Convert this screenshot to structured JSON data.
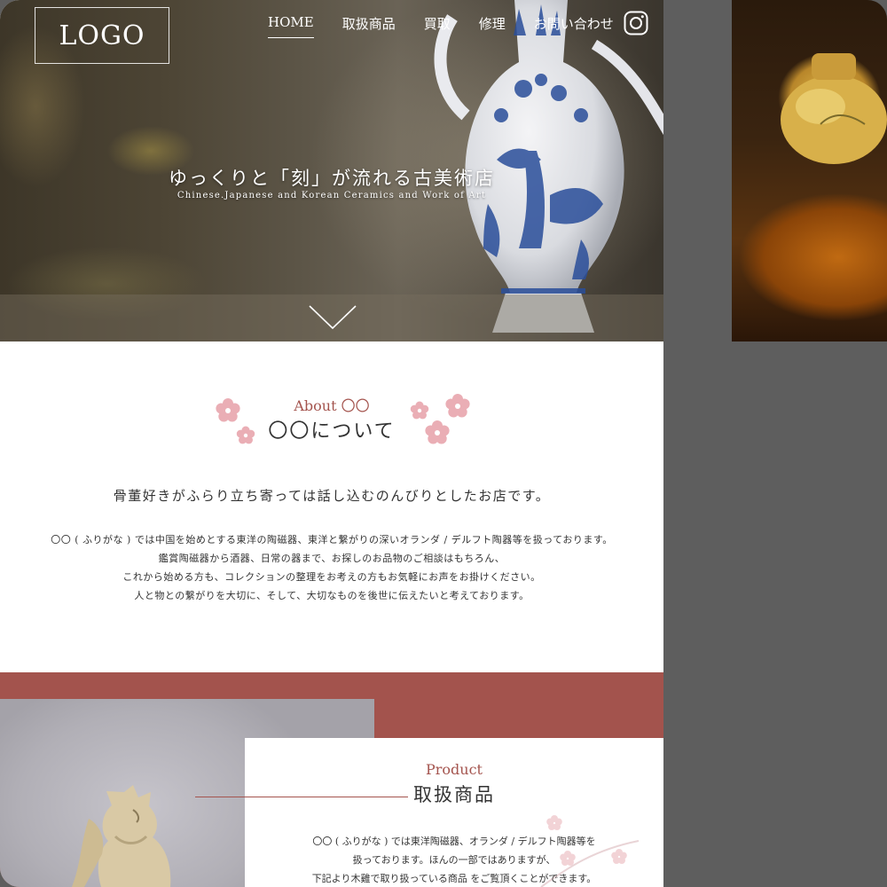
{
  "header": {
    "logo": "LOGO",
    "nav": [
      {
        "label": "HOME",
        "active": true
      },
      {
        "label": "取扱商品"
      },
      {
        "label": "買取"
      },
      {
        "label": "修理"
      },
      {
        "label": "お問い合わせ"
      }
    ],
    "instagram_icon": "instagram-icon"
  },
  "hero": {
    "title": "ゆっくりと「刻」が流れる古美術店",
    "subtitle": "Chinese.Japanese and Korean Ceramics and Work of Art",
    "scroll_icon": "chevron-down-icon"
  },
  "about": {
    "heading_en": "About 〇〇",
    "heading_jp": "〇〇について",
    "lead": "骨董好きがふらり立ち寄っては話し込むのんびりとしたお店です。",
    "body": [
      "〇〇 ( ふりがな ) では中国を始めとする東洋の陶磁器、東洋と繋がりの深いオランダ / デルフト陶器等を扱っております。",
      "鑑賞陶磁器から酒器、日常の器まで、お探しのお品物のご相談はもちろん、",
      "これから始める方も、コレクションの整理をお考えの方もお気軽にお声をお掛けください。",
      "人と物との繋がりを大切に、そして、大切なものを後世に伝えたいと考えております。"
    ]
  },
  "product": {
    "heading_en": "Product",
    "heading_jp": "取扱商品",
    "body": [
      "〇〇 ( ふりがな ) では東洋陶磁器、オランダ / デルフト陶器等を",
      "扱っております。ほんの一部ではありますが、",
      "下記より木雞で取り扱っている商品 をご覧頂くことができます。"
    ]
  },
  "colors": {
    "accent": "#a3534d",
    "blossom": "#e8a6ad",
    "background": "#5e5e5e"
  }
}
